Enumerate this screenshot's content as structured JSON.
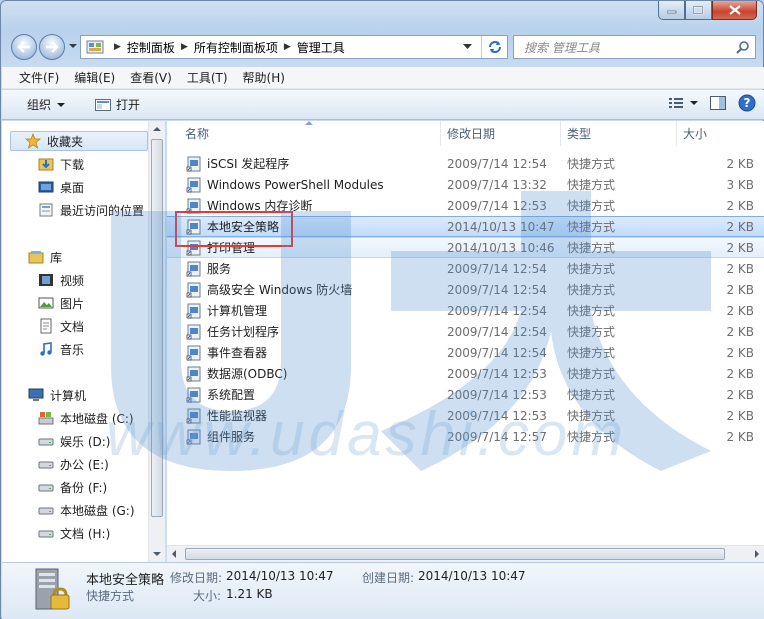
{
  "window": {
    "caption": {
      "minimize_icon": "minimize-icon",
      "maximize_icon": "maximize-icon",
      "close_icon": "close-icon"
    }
  },
  "address": {
    "crumbs": [
      "控制面板",
      "所有控制面板项",
      "管理工具"
    ],
    "search_placeholder": "搜索 管理工具"
  },
  "menu": [
    "文件(F)",
    "编辑(E)",
    "查看(V)",
    "工具(T)",
    "帮助(H)"
  ],
  "toolbar": {
    "organize": "组织",
    "open": "打开"
  },
  "nav": {
    "favorites": {
      "label": "收藏夹",
      "items": [
        "下载",
        "桌面",
        "最近访问的位置"
      ]
    },
    "libraries": {
      "label": "库",
      "items": [
        "视频",
        "图片",
        "文档",
        "音乐"
      ]
    },
    "computer": {
      "label": "计算机",
      "items": [
        "本地磁盘 (C:)",
        "娱乐 (D:)",
        "办公 (E:)",
        "备份 (F:)",
        "本地磁盘 (G:)",
        "文档 (H:)"
      ]
    }
  },
  "columns": {
    "name": "名称",
    "date": "修改日期",
    "type": "类型",
    "size": "大小"
  },
  "files": [
    {
      "name": "iSCSI 发起程序",
      "date": "2009/7/14 12:54",
      "type": "快捷方式",
      "size": "2 KB"
    },
    {
      "name": "Windows PowerShell Modules",
      "date": "2009/7/14 13:32",
      "type": "快捷方式",
      "size": "3 KB"
    },
    {
      "name": "Windows 内存诊断",
      "date": "2009/7/14 12:53",
      "type": "快捷方式",
      "size": "2 KB"
    },
    {
      "name": "本地安全策略",
      "date": "2014/10/13 10:47",
      "type": "快捷方式",
      "size": "2 KB"
    },
    {
      "name": "打印管理",
      "date": "2014/10/13 10:46",
      "type": "快捷方式",
      "size": "2 KB"
    },
    {
      "name": "服务",
      "date": "2009/7/14 12:54",
      "type": "快捷方式",
      "size": "2 KB"
    },
    {
      "name": "高级安全 Windows 防火墙",
      "date": "2009/7/14 12:54",
      "type": "快捷方式",
      "size": "2 KB"
    },
    {
      "name": "计算机管理",
      "date": "2009/7/14 12:54",
      "type": "快捷方式",
      "size": "2 KB"
    },
    {
      "name": "任务计划程序",
      "date": "2009/7/14 12:54",
      "type": "快捷方式",
      "size": "2 KB"
    },
    {
      "name": "事件查看器",
      "date": "2009/7/14 12:54",
      "type": "快捷方式",
      "size": "2 KB"
    },
    {
      "name": "数据源(ODBC)",
      "date": "2009/7/14 12:53",
      "type": "快捷方式",
      "size": "2 KB"
    },
    {
      "name": "系统配置",
      "date": "2009/7/14 12:53",
      "type": "快捷方式",
      "size": "2 KB"
    },
    {
      "name": "性能监视器",
      "date": "2009/7/14 12:53",
      "type": "快捷方式",
      "size": "2 KB"
    },
    {
      "name": "组件服务",
      "date": "2009/7/14 12:57",
      "type": "快捷方式",
      "size": "2 KB"
    }
  ],
  "details": {
    "name": "本地安全策略",
    "type": "快捷方式",
    "modified_label": "修改日期:",
    "modified_value": "2014/10/13 10:47",
    "size_label": "大小:",
    "size_value": "1.21 KB",
    "created_label": "创建日期:",
    "created_value": "2014/10/13 10:47"
  },
  "watermark": {
    "text": "www.udashi.com"
  },
  "colors": {
    "highlight_box": "#e53935",
    "selection": "#c1dcfc",
    "watermark": "#7da7d4"
  }
}
